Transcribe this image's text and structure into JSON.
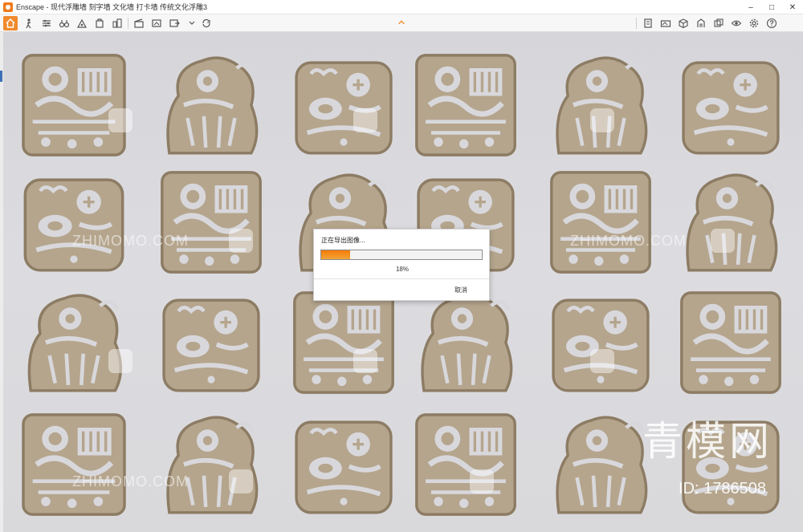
{
  "window": {
    "title": "Enscape - 现代浮雕墙 刻字墙 文化墙 打卡墙 传统文化浮雕3",
    "controls": {
      "minimize": "–",
      "maximize": "□",
      "close": "✕"
    }
  },
  "toolbar": {
    "left_icons": [
      "home-icon",
      "walk-mode-icon",
      "settings-sliders-icon",
      "binoculars-icon",
      "atmosphere-icon",
      "asset-library-icon",
      "buildings-icon",
      "clapperboard-icon",
      "screenshot-icon",
      "export-icon",
      "sync-icon"
    ],
    "right_icons": [
      "views-icon",
      "panorama-icon",
      "cube-icon",
      "asset-icon",
      "batch-render-icon",
      "vr-icon",
      "settings-gear-icon",
      "help-icon"
    ],
    "accent_color": "#f08a2c"
  },
  "dialog": {
    "title": "正在导出图像...",
    "progress": 0.18,
    "progress_label": "18%",
    "cancel_label": "取消"
  },
  "watermarks": {
    "site_text": "ZHIMOMO.COM",
    "brand": "青模网",
    "id_label": "ID: 1786508"
  },
  "colors": {
    "relief": "#b4a48c",
    "relief_shadow": "#8d7c64",
    "background": "#d8d8dc",
    "progress": "#f57b0a"
  }
}
